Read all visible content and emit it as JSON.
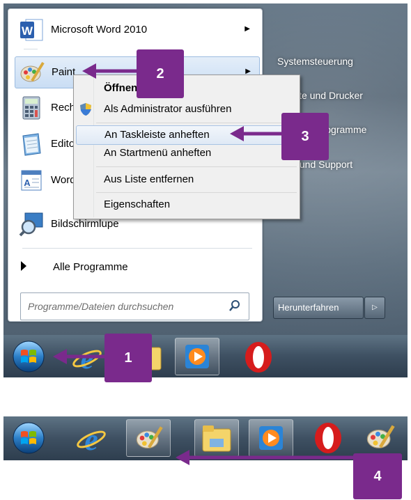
{
  "start_menu": {
    "pinned_program": "Microsoft Word 2010",
    "programs": [
      {
        "label": "Paint",
        "icon": "paint-icon"
      },
      {
        "label": "Rechner",
        "icon": "calculator-icon"
      },
      {
        "label": "Editor",
        "icon": "notepad-icon"
      },
      {
        "label": "WordPad",
        "icon": "wordpad-icon"
      },
      {
        "label": "Bildschirmlupe",
        "icon": "magnifier-icon"
      }
    ],
    "all_programs": "Alle Programme",
    "search_placeholder": "Programme/Dateien durchsuchen",
    "right_items": [
      "Systemsteuerung",
      "Geräte und Drucker",
      "Standardprogramme",
      "Hilfe und Support"
    ],
    "shutdown": "Herunterfahren"
  },
  "context_menu": {
    "items": [
      "Öffnen",
      "Als Administrator ausführen",
      "An Taskleiste anheften",
      "An Startmenü anheften",
      "Aus Liste entfernen",
      "Eigenschaften"
    ],
    "highlighted": "An Taskleiste anheften"
  },
  "taskbar_top": [
    "start-orb-icon",
    "internet-explorer-icon",
    "explorer-folder-icon",
    "media-player-icon",
    "opera-icon"
  ],
  "taskbar_bottom": [
    "start-orb-icon",
    "internet-explorer-icon",
    "paint-icon",
    "explorer-folder-icon",
    "media-player-icon",
    "opera-icon",
    "paint-icon"
  ],
  "callouts": {
    "c1": "1",
    "c2": "2",
    "c3": "3",
    "c4": "4"
  },
  "colors": {
    "callout": "#7a2a8c",
    "arrow": "#7a2a8c"
  }
}
